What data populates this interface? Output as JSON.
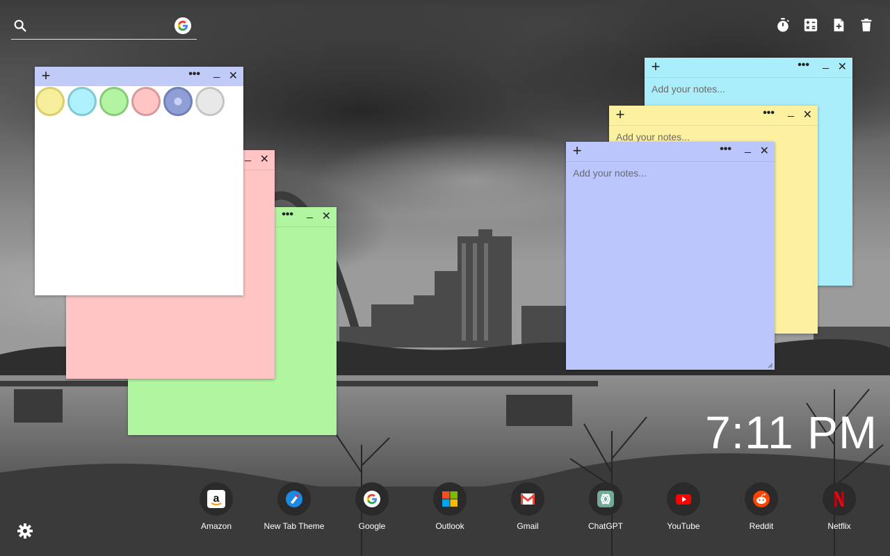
{
  "search": {
    "placeholder": "",
    "value": ""
  },
  "toolbar": {
    "items": [
      {
        "icon": "timer-icon"
      },
      {
        "icon": "calculator-icon"
      },
      {
        "icon": "add-note-icon"
      },
      {
        "icon": "delete-icon"
      }
    ]
  },
  "notes": {
    "placeholder": "Add your notes...",
    "plus": "+",
    "dots": "•••",
    "min": "_",
    "close": "✕",
    "colors": {
      "white": "#ffffff",
      "pink": "#ffc4c4",
      "green": "#b0f5a0",
      "cyan": "#aaeefc",
      "yellow": "#fcf1a0",
      "blue": "#bac6fc",
      "blue_header": "#c0cbf8"
    }
  },
  "swatches": [
    {
      "name": "yellow",
      "fill": "#f7ee9c",
      "ring": "#d9cd6e"
    },
    {
      "name": "cyan",
      "fill": "#aef0fb",
      "ring": "#7fc9d5"
    },
    {
      "name": "green",
      "fill": "#b2f4a2",
      "ring": "#86cc78"
    },
    {
      "name": "pink",
      "fill": "#ffc4c4",
      "ring": "#d89a9a"
    },
    {
      "name": "blue",
      "fill": "#8f9fd6",
      "ring": "#6f7fb8"
    },
    {
      "name": "grey",
      "fill": "#e8e8e8",
      "ring": "#c4c4c4"
    }
  ],
  "clock": {
    "time": "7:11 PM"
  },
  "shortcuts": [
    {
      "label": "Amazon",
      "icon": "amazon-icon"
    },
    {
      "label": "New Tab Theme",
      "icon": "new-tab-theme-icon"
    },
    {
      "label": "Google",
      "icon": "google-icon"
    },
    {
      "label": "Outlook",
      "icon": "outlook-icon"
    },
    {
      "label": "Gmail",
      "icon": "gmail-icon"
    },
    {
      "label": "ChatGPT",
      "icon": "chatgpt-icon"
    },
    {
      "label": "YouTube",
      "icon": "youtube-icon"
    },
    {
      "label": "Reddit",
      "icon": "reddit-icon"
    },
    {
      "label": "Netflix",
      "icon": "netflix-icon"
    }
  ]
}
